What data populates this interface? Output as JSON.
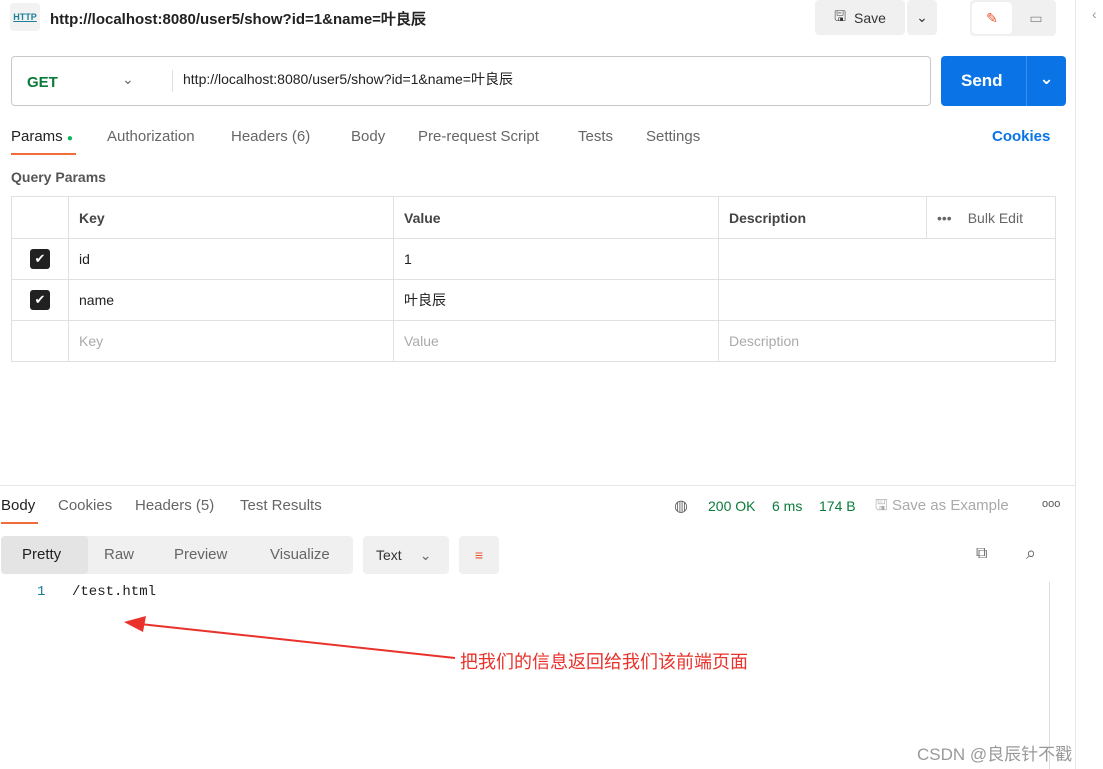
{
  "header": {
    "icon": "http-icon",
    "title": "http://localhost:8080/user5/show?id=1&name=叶良辰",
    "save_label": "Save"
  },
  "request": {
    "method": "GET",
    "url": "http://localhost:8080/user5/show?id=1&name=叶良辰",
    "send_label": "Send"
  },
  "tabs": [
    {
      "label": "Params"
    },
    {
      "label": "Authorization"
    },
    {
      "label": "Headers (6)"
    },
    {
      "label": "Body"
    },
    {
      "label": "Pre-request Script"
    },
    {
      "label": "Tests"
    },
    {
      "label": "Settings"
    }
  ],
  "cookies_label": "Cookies",
  "query_params": {
    "title": "Query Params",
    "headers": [
      "Key",
      "Value",
      "Description"
    ],
    "bulk_edit": "Bulk Edit",
    "rows": [
      {
        "key": "id",
        "value": "1",
        "description": "",
        "checked": true
      },
      {
        "key": "name",
        "value": "叶良辰",
        "description": "",
        "checked": true
      }
    ],
    "placeholder": {
      "key": "Key",
      "value": "Value",
      "description": "Description"
    }
  },
  "response": {
    "tabs": [
      {
        "label": "Body"
      },
      {
        "label": "Cookies"
      },
      {
        "label": "Headers (5)"
      },
      {
        "label": "Test Results"
      }
    ],
    "status": "200 OK",
    "time": "6 ms",
    "size": "174 B",
    "save_example": "Save as Example",
    "views": [
      "Pretty",
      "Raw",
      "Preview",
      "Visualize"
    ],
    "format": "Text",
    "lines": [
      {
        "n": "1",
        "text": "/test.html"
      }
    ]
  },
  "annotation": "把我们的信息返回给我们该前端页面",
  "watermark": "CSDN @良辰针不戳",
  "colors": {
    "accent": "#0a74e6",
    "status": "#0b7a3a",
    "annotation": "#e8322b",
    "tab_underline": "#f26b3a"
  }
}
